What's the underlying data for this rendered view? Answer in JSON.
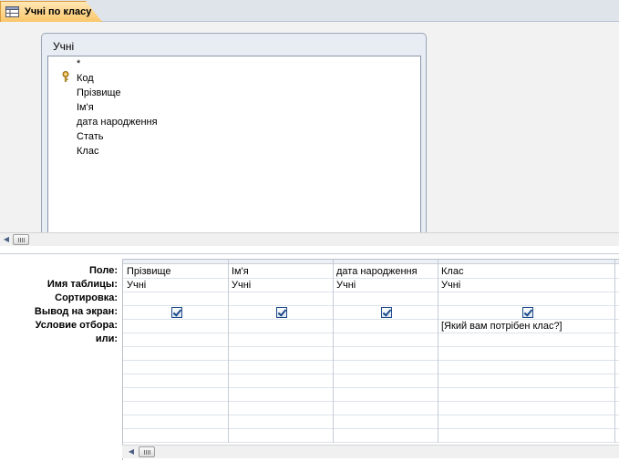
{
  "tab": {
    "label": "Учні по класу",
    "icon": "query-icon"
  },
  "field_list": {
    "title": "Учні",
    "fields": [
      "*",
      "Код",
      "Прізвище",
      "Ім'я",
      "дата народження",
      "Стать",
      "Клас"
    ],
    "key_icon": "key-icon"
  },
  "grid": {
    "row_labels": {
      "field": "Поле:",
      "table": "Имя таблицы:",
      "sort": "Сортировка:",
      "show": "Вывод на экран:",
      "criteria": "Условие отбора:",
      "or": "или:"
    },
    "columns": [
      {
        "field": "Прізвище",
        "table": "Учні",
        "sort": "",
        "show": true,
        "criteria": ""
      },
      {
        "field": "Ім'я",
        "table": "Учні",
        "sort": "",
        "show": true,
        "criteria": ""
      },
      {
        "field": "дата народження",
        "table": "Учні",
        "sort": "",
        "show": true,
        "criteria": ""
      },
      {
        "field": "Клас",
        "table": "Учні",
        "sort": "",
        "show": true,
        "criteria": "[Який вам потрібен клас?]"
      }
    ]
  },
  "scrollbars": {
    "left_arrow_icon": "scroll-left-arrow-icon"
  }
}
